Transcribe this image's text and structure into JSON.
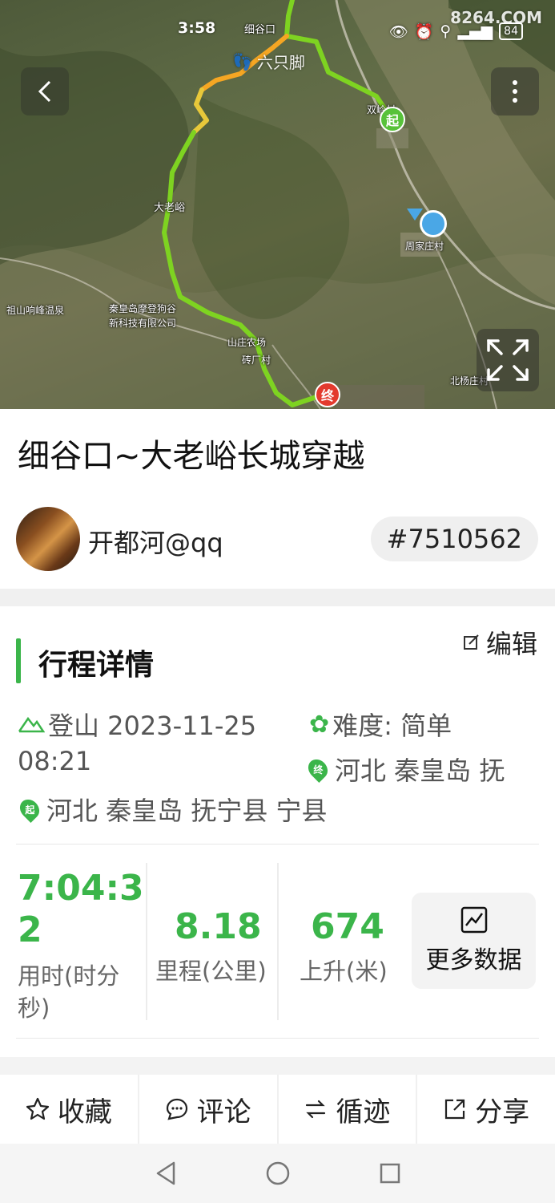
{
  "status_bar": {
    "time": "3:58",
    "battery": "84",
    "watermark": "8264.COM"
  },
  "map": {
    "brand": "六只脚",
    "labels": {
      "top_village": "细谷口",
      "right_village": "双岭村",
      "pass": "大老峪",
      "wenquan": "祖山响峰温泉",
      "company": "秦皇岛摩登狗谷",
      "company2": "新科技有限公司",
      "field": "山庄农场",
      "factory": "砖厂村",
      "south_village": "周家庄村",
      "north_yang": "北杨庄村"
    },
    "start_marker": "起",
    "end_marker": "终"
  },
  "track": {
    "title": "细谷口~大老峪长城穿越",
    "username": "开都河@qq",
    "record_id": "#7510562"
  },
  "details": {
    "section_title": "行程详情",
    "edit_label": "编辑",
    "activity": "登山 2023-11-25",
    "time": "08:21",
    "difficulty": "难度: 简单",
    "end_place": "河北 秦皇岛 抚",
    "start_place": "河北 秦皇岛 抚宁县 宁县",
    "start_pin": "起",
    "end_pin": "终"
  },
  "stats": {
    "duration_line1": "7:04:3",
    "duration_line2": "2",
    "duration_label_line1": "用时(时分",
    "duration_label_line2": "秒)",
    "distance": "8.18",
    "distance_label": "里程(公里)",
    "ascent": "674",
    "ascent_label": "上升(米)",
    "more_label": "更多数据"
  },
  "actions": {
    "favorite": "收藏",
    "comment": "评论",
    "follow_track": "循迹",
    "share": "分享"
  },
  "colors": {
    "accent_green": "#3bb54a",
    "track_green": "#7ed321",
    "track_orange": "#f5a623",
    "end_red": "#e33a2e",
    "location_blue": "#4aa7e6"
  }
}
